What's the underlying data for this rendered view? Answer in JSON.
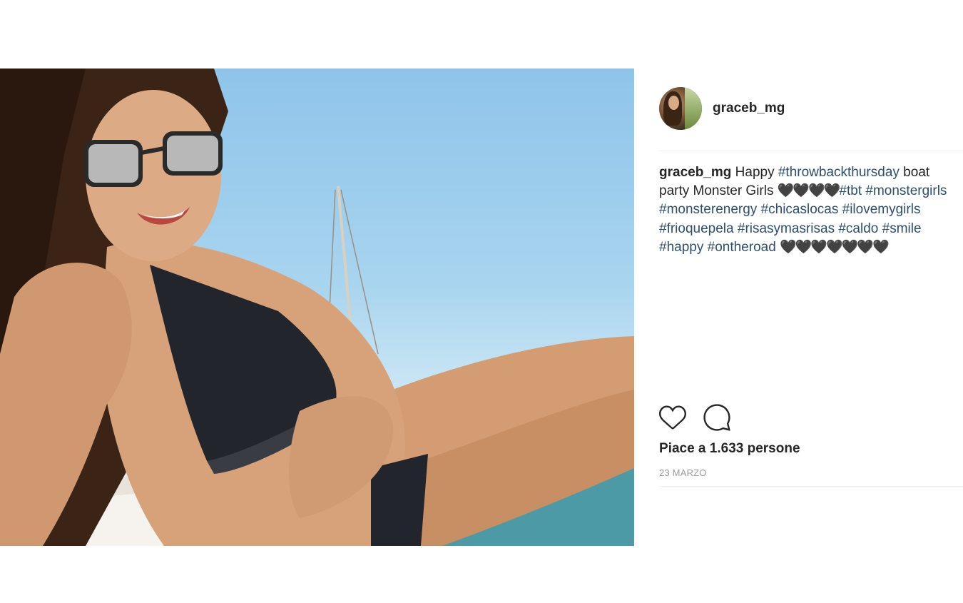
{
  "post": {
    "username": "graceb_mg",
    "caption": {
      "username": "graceb_mg",
      "segments": [
        {
          "text": "Happy ",
          "type": "text"
        },
        {
          "text": "#throwbackthursday",
          "type": "tag"
        },
        {
          "text": " boat party Monster Girls ",
          "type": "text"
        },
        {
          "text": "🖤🖤🖤🖤",
          "type": "hearts"
        },
        {
          "text": "#tbt",
          "type": "tag"
        },
        {
          "text": " ",
          "type": "text"
        },
        {
          "text": "#monstergirls",
          "type": "tag"
        },
        {
          "text": " ",
          "type": "text"
        },
        {
          "text": "#monsterenergy",
          "type": "tag"
        },
        {
          "text": " ",
          "type": "text"
        },
        {
          "text": "#chicaslocas",
          "type": "tag"
        },
        {
          "text": " ",
          "type": "text"
        },
        {
          "text": "#ilovemygirls",
          "type": "tag"
        },
        {
          "text": " ",
          "type": "text"
        },
        {
          "text": "#frioquepela",
          "type": "tag"
        },
        {
          "text": " ",
          "type": "text"
        },
        {
          "text": "#risasymasrisas",
          "type": "tag"
        },
        {
          "text": " ",
          "type": "text"
        },
        {
          "text": "#caldo",
          "type": "tag"
        },
        {
          "text": " ",
          "type": "text"
        },
        {
          "text": "#smile",
          "type": "tag"
        },
        {
          "text": " ",
          "type": "text"
        },
        {
          "text": "#happy",
          "type": "tag"
        },
        {
          "text": " ",
          "type": "text"
        },
        {
          "text": "#ontheroad",
          "type": "tag"
        },
        {
          "text": " ",
          "type": "text"
        },
        {
          "text": "🖤🖤🖤🖤🖤🖤🖤",
          "type": "hearts"
        }
      ]
    },
    "likes_text": "Piace a 1.633 persone",
    "date": "23 MARZO",
    "icons": {
      "like": "heart-icon",
      "comment": "comment-icon"
    },
    "colors": {
      "hashtag": "#2d4e6e",
      "text": "#262626",
      "muted": "#999999",
      "divider": "#efefef"
    }
  }
}
